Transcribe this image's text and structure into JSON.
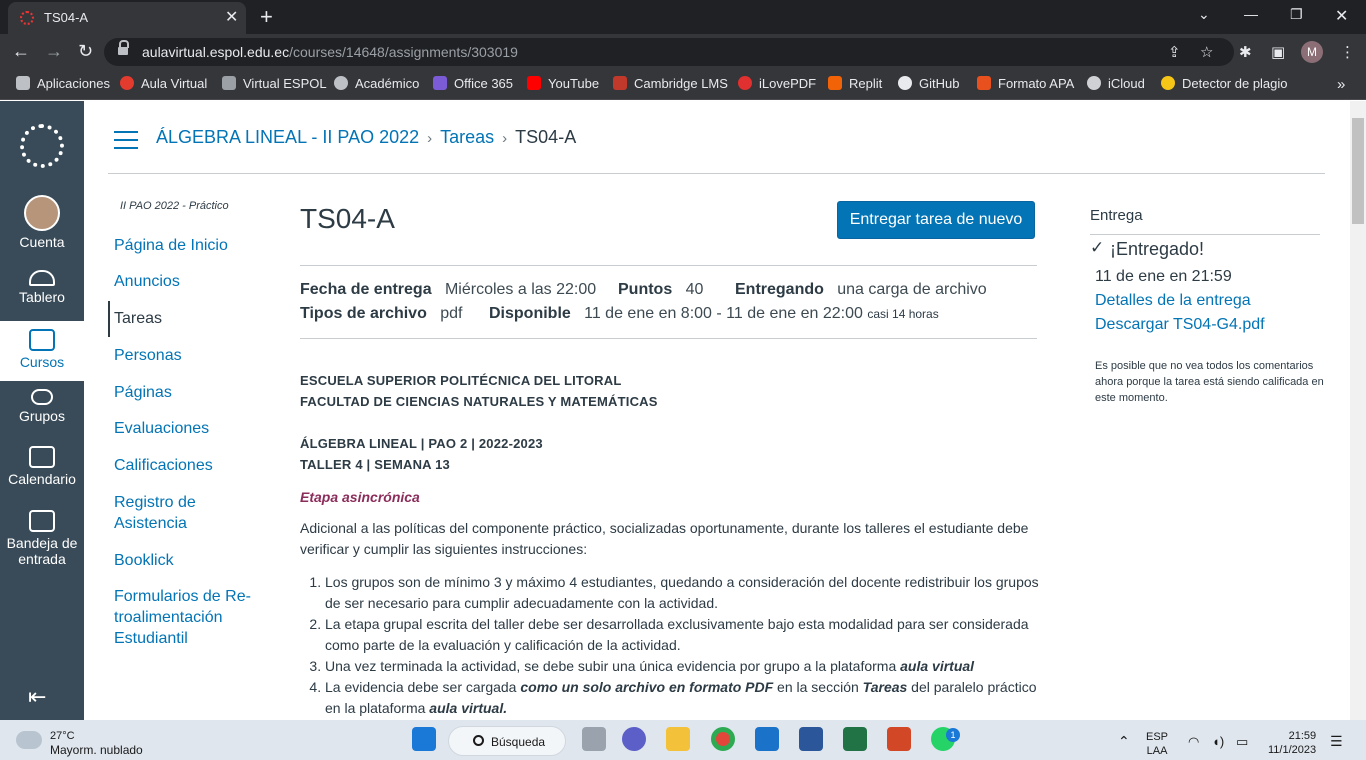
{
  "browser": {
    "tab_title": "TS04-A",
    "url_host": "aulavirtual.espol.edu.ec",
    "url_path": "/courses/14648/assignments/303019",
    "profile_initial": "M",
    "bookmarks": [
      "Aplicaciones",
      "Aula Virtual",
      "Virtual ESPOL",
      "Académico",
      "Office 365",
      "YouTube",
      "Cambridge LMS",
      "iLovePDF",
      "Replit",
      "GitHub",
      "Formato APA",
      "iCloud",
      "Detector de plagio"
    ],
    "bookmark_colors": [
      "#e8eaed",
      "#e33b2e",
      "#9aa0a6",
      "#bdc1c6",
      "#7b5cd6",
      "#ff0000",
      "#c0392b",
      "#e0302f",
      "#f26207",
      "#e8eaed",
      "#e8501e",
      "#cfd1d4",
      "#f5c518"
    ]
  },
  "global_nav": {
    "account": "Cuenta",
    "dashboard": "Tablero",
    "courses": "Cursos",
    "groups": "Grupos",
    "calendar": "Calendario",
    "inbox_line1": "Bandeja de",
    "inbox_line2": "entrada"
  },
  "breadcrumb": {
    "course": "ÁLGEBRA LINEAL - II PAO 2022",
    "section": "Tareas",
    "current": "TS04-A"
  },
  "course_nav": {
    "term": "II PAO 2022 - Práctico",
    "items": [
      "Página de Inicio",
      "Anuncios",
      "Tareas",
      "Personas",
      "Páginas",
      "Evaluaciones",
      "Calificaciones",
      "Registro de",
      "Asistencia",
      "Booklick",
      "Formularios de Re-",
      "troalimentación",
      "Estudiantil"
    ]
  },
  "assignment": {
    "title": "TS04-A",
    "resubmit_label": "Entregar tarea de nuevo",
    "due_label": "Fecha de entrega",
    "due_value": "Miércoles a las 22:00",
    "points_label": "Puntos",
    "points_value": "40",
    "submitting_label": "Entregando",
    "submitting_value": "una carga de archivo",
    "filetypes_label": "Tipos de archivo",
    "filetypes_value": "pdf",
    "available_label": "Disponible",
    "available_value": "11 de ene en 8:00 - 11 de ene en 22:00",
    "available_note": "casi 14 horas"
  },
  "content": {
    "h1": "ESCUELA SUPERIOR POLITÉCNICA DEL LITORAL",
    "h2": "FACULTAD DE CIENCIAS NATURALES Y MATEMÁTICAS",
    "h3": "ÁLGEBRA LINEAL | PAO 2 | 2022-2023",
    "h4": "TALLER  4  | SEMANA 13",
    "etapa": "Etapa asincrónica",
    "intro": "Adicional a las políticas del componente práctico, socializadas oportunamente, durante los talleres el estudiante debe verificar y cumplir las siguientes instrucciones:",
    "li1": "Los grupos son de mínimo 3 y máximo 4 estudiantes, quedando a consideración del docente redistribuir los grupos de ser necesario para cumplir adecuadamente con la actividad.",
    "li2": "La etapa grupal escrita del taller debe ser desarrollada exclusivamente bajo esta modalidad para ser considerada como parte de la evaluación y calificación de la actividad.",
    "li3a": "Una vez terminada la actividad, se debe subir una única evidencia por grupo a la plataforma ",
    "li3b": "aula virtual",
    "li4a": "La evidencia debe ser cargada ",
    "li4b": "como un solo archivo en formato PDF",
    "li4c": " en la sección ",
    "li4d": "Tareas",
    "li4e": " del paralelo práctico en la plataforma ",
    "li4f": "aula virtual."
  },
  "submission": {
    "heading": "Entrega",
    "status": "¡Entregado!",
    "date": "11 de ene en 21:59",
    "details_link": "Detalles de la entrega",
    "download_link": "Descargar TS04-G4.pdf",
    "note": "Es posible que no vea todos los comentarios ahora porque la tarea está siendo calificada en este momento."
  },
  "taskbar": {
    "weather_temp": "27°C",
    "weather_desc": "Mayorm. nublado",
    "search": "Búsqueda",
    "lang1": "ESP",
    "lang2": "LAA",
    "time": "21:59",
    "date": "11/1/2023",
    "whatsapp_badge": "1"
  }
}
